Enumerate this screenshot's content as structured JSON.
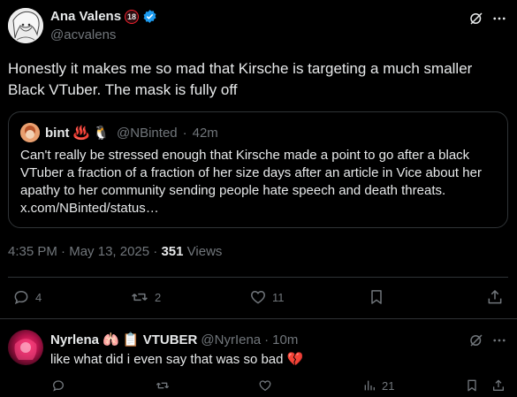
{
  "tweet": {
    "author_name": "Ana Valens",
    "age_badge": "18",
    "handle": "@acvalens",
    "text": "Honestly it makes me so mad that Kirsche is targeting a much smaller Black VTuber. The mask is fully off",
    "time": "4:35 PM",
    "separator": "·",
    "date": "May 13, 2025",
    "views_count": "351",
    "views_label": "Views"
  },
  "quote": {
    "author_name": "bint",
    "author_emoji": "♨️ 🐧",
    "handle": "@NBinted",
    "separator": "·",
    "age": "42m",
    "text": "Can't really be stressed enough that Kirsche made a point to go after a black VTuber a fraction of a fraction of her size days after an article in Vice about her apathy to her community sending people hate speech and death threats. x.com/NBinted/status…"
  },
  "actions": {
    "replies": "4",
    "reposts": "2",
    "likes": "11"
  },
  "reply": {
    "author_name": "Nyrlena",
    "name_suffix": "🫁 📋 VTUBER",
    "handle": "@NyrIena",
    "separator": "·",
    "age": "10m",
    "text": "like what did i even say that was so bad 💔",
    "views": "21"
  },
  "colors": {
    "background": "#000000",
    "text": "#e7e9ea",
    "muted": "#71767b",
    "divider": "#2f3336",
    "verified": "#1d9bf0",
    "badge_border": "#f4212e"
  }
}
